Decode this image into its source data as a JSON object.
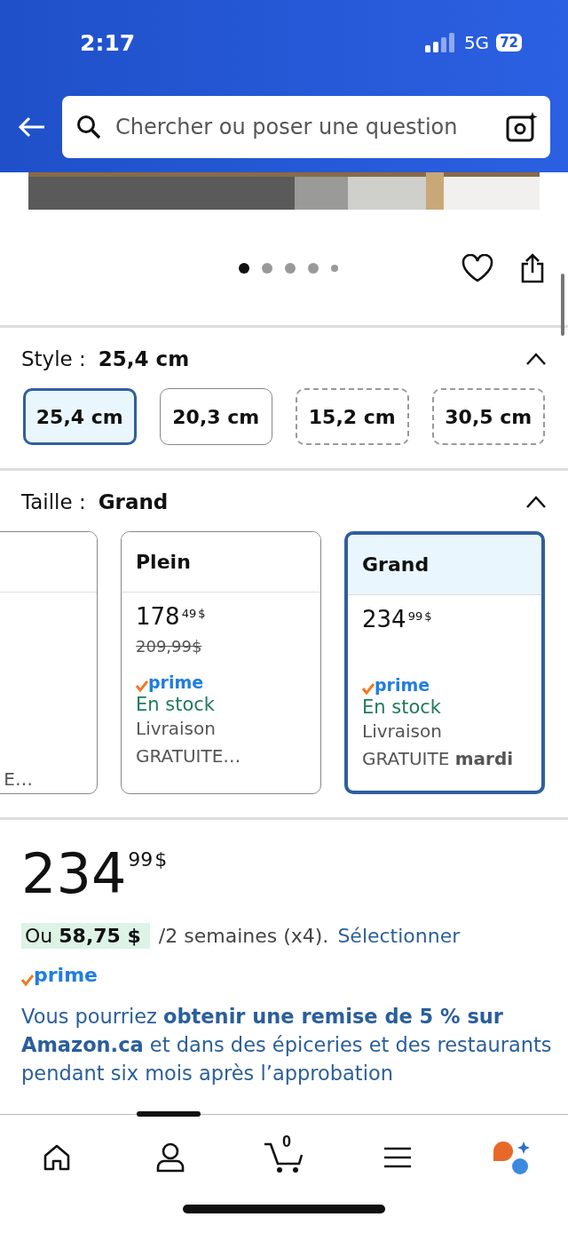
{
  "status_bar": {
    "time": "2:17",
    "network": "5G",
    "battery": "72"
  },
  "search": {
    "placeholder": "Chercher ou poser une question"
  },
  "gallery": {
    "dots": [
      {
        "selected": true
      },
      {
        "selected": false
      },
      {
        "selected": false
      },
      {
        "selected": false
      },
      {
        "selected": false
      }
    ]
  },
  "style": {
    "label": "Style :",
    "value": "25,4 cm",
    "expanded": true,
    "options": [
      {
        "label": "25,4 cm",
        "selected": true,
        "available": true
      },
      {
        "label": "20,3 cm",
        "selected": false,
        "available": true
      },
      {
        "label": "15,2 cm",
        "selected": false,
        "available": false
      },
      {
        "label": "30,5 cm",
        "selected": false,
        "available": false
      }
    ]
  },
  "size": {
    "label": "Taille :",
    "value": "Grand",
    "expanded": true,
    "options": [
      {
        "selected": false,
        "lines": [
          "E…"
        ]
      },
      {
        "title": "Plein",
        "selected": false,
        "price_whole": "178",
        "price_fraction": "49",
        "currency": "$",
        "list_price": "209,99$",
        "prime": "prime",
        "stock": "En stock",
        "lines": [
          "Livraison",
          "GRATUITE…"
        ]
      },
      {
        "title": "Grand",
        "selected": true,
        "price_whole": "234",
        "price_fraction": "99",
        "currency": "$",
        "prime": "prime",
        "stock": "En stock",
        "lines": [
          "Livraison",
          "GRATUITE **mardi**"
        ]
      }
    ]
  },
  "price": {
    "whole": "234",
    "fraction": "99",
    "currency": "$"
  },
  "installment": {
    "offer": "Ou **58,75 $**",
    "terms": "/2 semaines (x4).",
    "link": "Sélectionner"
  },
  "prime": "prime",
  "promo": "Vous pourriez **obtenir une remise de 5 % sur Amazon.ca** et dans des épiceries et des restaurants pendant six mois après l’approbation",
  "nav": [
    {
      "kind": "home"
    },
    {
      "kind": "account"
    },
    {
      "kind": "cart",
      "count": "0"
    },
    {
      "kind": "menu"
    },
    {
      "kind": "assistant"
    }
  ]
}
